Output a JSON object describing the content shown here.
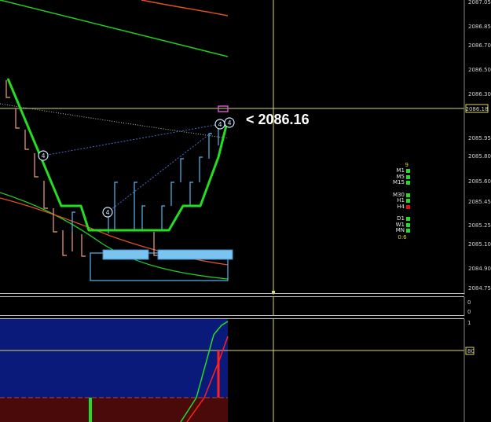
{
  "main_chart": {
    "price_axis": [
      "2087.05",
      "2086.85",
      "2086.70",
      "2086.50",
      "2086.30",
      "2086.18",
      "2085.95",
      "2085.80",
      "2085.60",
      "2085.45",
      "2085.25",
      "2085.10",
      "2084.90",
      "2084.75"
    ],
    "current_price_tag": "2086.18",
    "current_price_label": "<  2086.16",
    "order_markers": [
      "4",
      "4",
      "4",
      "4"
    ]
  },
  "timeframe_panel": {
    "top_value": "9",
    "rows": [
      {
        "label": "M1",
        "color": "#22dd22"
      },
      {
        "label": "M5",
        "color": "#22dd22"
      },
      {
        "label": "M15",
        "color": "#22dd22"
      },
      {
        "gap": true
      },
      {
        "label": "M30",
        "color": "#22dd22"
      },
      {
        "label": "H1",
        "color": "#22dd22"
      },
      {
        "label": "H4",
        "color": "#e01010"
      },
      {
        "gap": true
      },
      {
        "label": "D1",
        "color": "#22dd22"
      },
      {
        "label": "W1",
        "color": "#22dd22"
      },
      {
        "label": "MN",
        "color": "#22dd22"
      }
    ],
    "bottom_value": "0:6"
  },
  "sub_panel_1": {
    "axis": [
      "0",
      "0"
    ]
  },
  "sub_panel_2": {
    "axis_top": "1",
    "level_tag": "80"
  },
  "colors": {
    "background": "#000000",
    "crosshair": "#d8d860",
    "bull_candle": "#58b8f0",
    "bear_candle": "#f0a080",
    "channel_green": "#22dd22",
    "ma_red": "#e05020",
    "oscillator_blue": "#0a1a7a",
    "oscillator_red": "#4a0a0a"
  }
}
